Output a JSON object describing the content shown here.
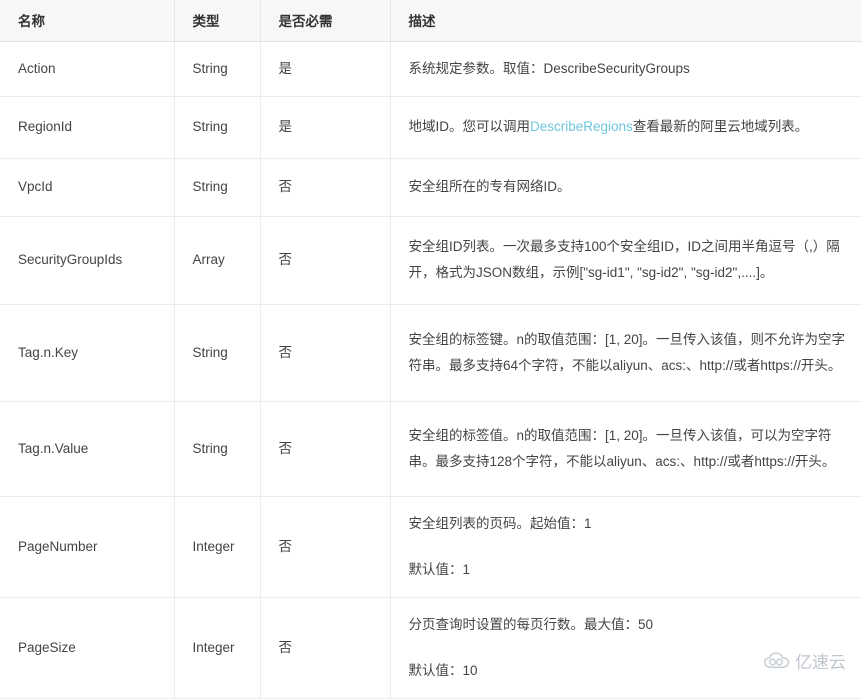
{
  "table": {
    "columns": [
      {
        "key": "name",
        "label": "名称"
      },
      {
        "key": "type",
        "label": "类型"
      },
      {
        "key": "required",
        "label": "是否必需"
      },
      {
        "key": "description",
        "label": "描述"
      }
    ],
    "rows": [
      {
        "name": "Action",
        "type": "String",
        "required": "是",
        "description_lines": [
          "系统规定参数。取值：DescribeSecurityGroups"
        ]
      },
      {
        "name": "RegionId",
        "type": "String",
        "required": "是",
        "description_prefix": "地域ID。您可以调用",
        "description_link": "DescribeRegions",
        "description_suffix": "查看最新的阿里云地域列表。"
      },
      {
        "name": "VpcId",
        "type": "String",
        "required": "否",
        "description_lines": [
          "安全组所在的专有网络ID。"
        ]
      },
      {
        "name": "SecurityGroupIds",
        "type": "Array",
        "required": "否",
        "description_lines": [
          "安全组ID列表。一次最多支持100个安全组ID，ID之间用半角逗号（,）隔开，格式为JSON数组，示例[\"sg-id1\", \"sg-id2\", \"sg-id2\",....]。"
        ]
      },
      {
        "name": "Tag.n.Key",
        "type": "String",
        "required": "否",
        "description_lines": [
          "安全组的标签键。n的取值范围：[1, 20]。一旦传入该值，则不允许为空字符串。最多支持64个字符，不能以aliyun、acs:、http://或者https://开头。"
        ]
      },
      {
        "name": "Tag.n.Value",
        "type": "String",
        "required": "否",
        "description_lines": [
          "安全组的标签值。n的取值范围：[1, 20]。一旦传入该值，可以为空字符串。最多支持128个字符，不能以aliyun、acs:、http://或者https://开头。"
        ]
      },
      {
        "name": "PageNumber",
        "type": "Integer",
        "required": "否",
        "description_lines": [
          "安全组列表的页码。起始值：1",
          "默认值：1"
        ]
      },
      {
        "name": "PageSize",
        "type": "Integer",
        "required": "否",
        "description_lines": [
          "分页查询时设置的每页行数。最大值：50",
          "默认值：10"
        ]
      }
    ]
  },
  "watermark": {
    "text": "亿速云",
    "icon": "cloud-logo-icon",
    "color": "#8c98a8"
  },
  "colors": {
    "link": "#6ec6de",
    "header_background": "#f7f7f7",
    "border": "#ececec",
    "text": "#444444"
  }
}
